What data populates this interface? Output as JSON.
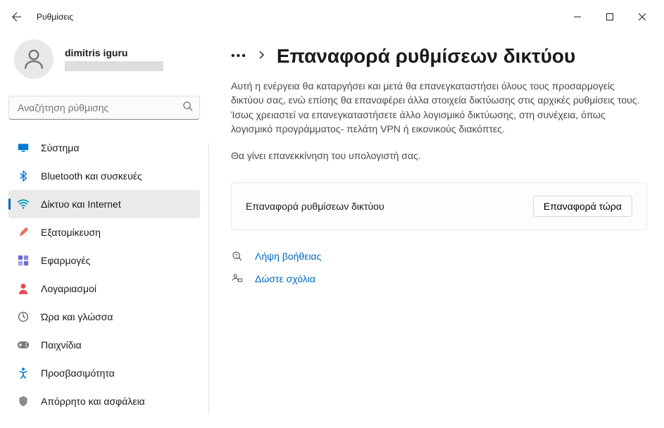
{
  "titlebar": {
    "title": "Ρυθμίσεις"
  },
  "profile": {
    "name": "dimitris iguru"
  },
  "search": {
    "placeholder": "Αναζήτηση ρύθμισης"
  },
  "sidebar": {
    "items": [
      {
        "label": "Σύστημα",
        "icon": "display-icon",
        "color": "#0078d4"
      },
      {
        "label": "Bluetooth και συσκευές",
        "icon": "bluetooth-icon",
        "color": "#0078d4"
      },
      {
        "label": "Δίκτυο και Internet",
        "icon": "wifi-icon",
        "color": "#0099bc",
        "active": true
      },
      {
        "label": "Εξατομίκευση",
        "icon": "paintbrush-icon",
        "color": "#e3735e"
      },
      {
        "label": "Εφαρμογές",
        "icon": "apps-icon",
        "color": "#6b69d6"
      },
      {
        "label": "Λογαριασμοί",
        "icon": "person-icon",
        "color": "#e74856"
      },
      {
        "label": "Ώρα και γλώσσα",
        "icon": "clock-globe-icon",
        "color": "#5d5a58"
      },
      {
        "label": "Παιχνίδια",
        "icon": "gamepad-icon",
        "color": "#767676"
      },
      {
        "label": "Προσβασιμότητα",
        "icon": "accessibility-icon",
        "color": "#0078d4"
      },
      {
        "label": "Απόρρητο και ασφάλεια",
        "icon": "shield-icon",
        "color": "#898989"
      }
    ]
  },
  "main": {
    "heading": "Επαναφορά ρυθμίσεων δικτύου",
    "description": "Αυτή η ενέργεια θα καταργήσει και μετά θα επανεγκαταστήσει όλους τους προσαρμογείς δικτύου σας, ενώ επίσης θα επαναφέρει άλλα στοιχεία δικτύωσης στις αρχικές ρυθμίσεις τους. Ίσως χρειαστεί να επανεγκαταστήσετε άλλο λογισμικό δικτύωσης, στη συνέχεια, όπως λογισμικό προγράμματος- πελάτη VPN ή εικονικούς διακόπτες.",
    "note": "Θα γίνει επανεκκίνηση του υπολογιστή σας.",
    "card": {
      "label": "Επαναφορά ρυθμίσεων δικτύου",
      "button": "Επαναφορά τώρα"
    },
    "links": {
      "help": "Λήψη βοήθειας",
      "feedback": "Δώστε σχόλια"
    }
  }
}
